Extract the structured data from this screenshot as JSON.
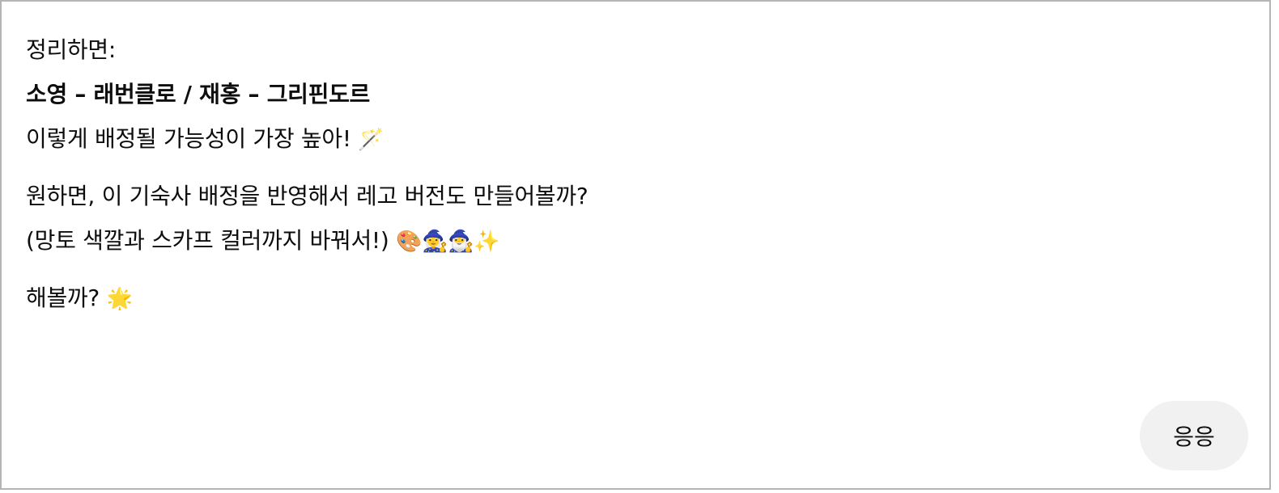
{
  "assistant_message": {
    "summary_label": "정리하면:",
    "assignment_line": "소영 – 래번클로 / 재홍 – 그리핀도르",
    "likelihood_line": "이렇게 배정될 가능성이 가장 높아!",
    "likelihood_emoji": "🪄",
    "offer_line": "원하면, 이 기숙사 배정을 반영해서 레고 버전도 만들어볼까?",
    "detail_line": "(망토 색깔과 스카프 컬러까지 바꿔서!)",
    "detail_emoji": "🎨🧙‍♀️🧙‍♂️✨",
    "closing_line": "해볼까?",
    "closing_emoji": "🌟"
  },
  "user_message": {
    "text": "응응"
  }
}
